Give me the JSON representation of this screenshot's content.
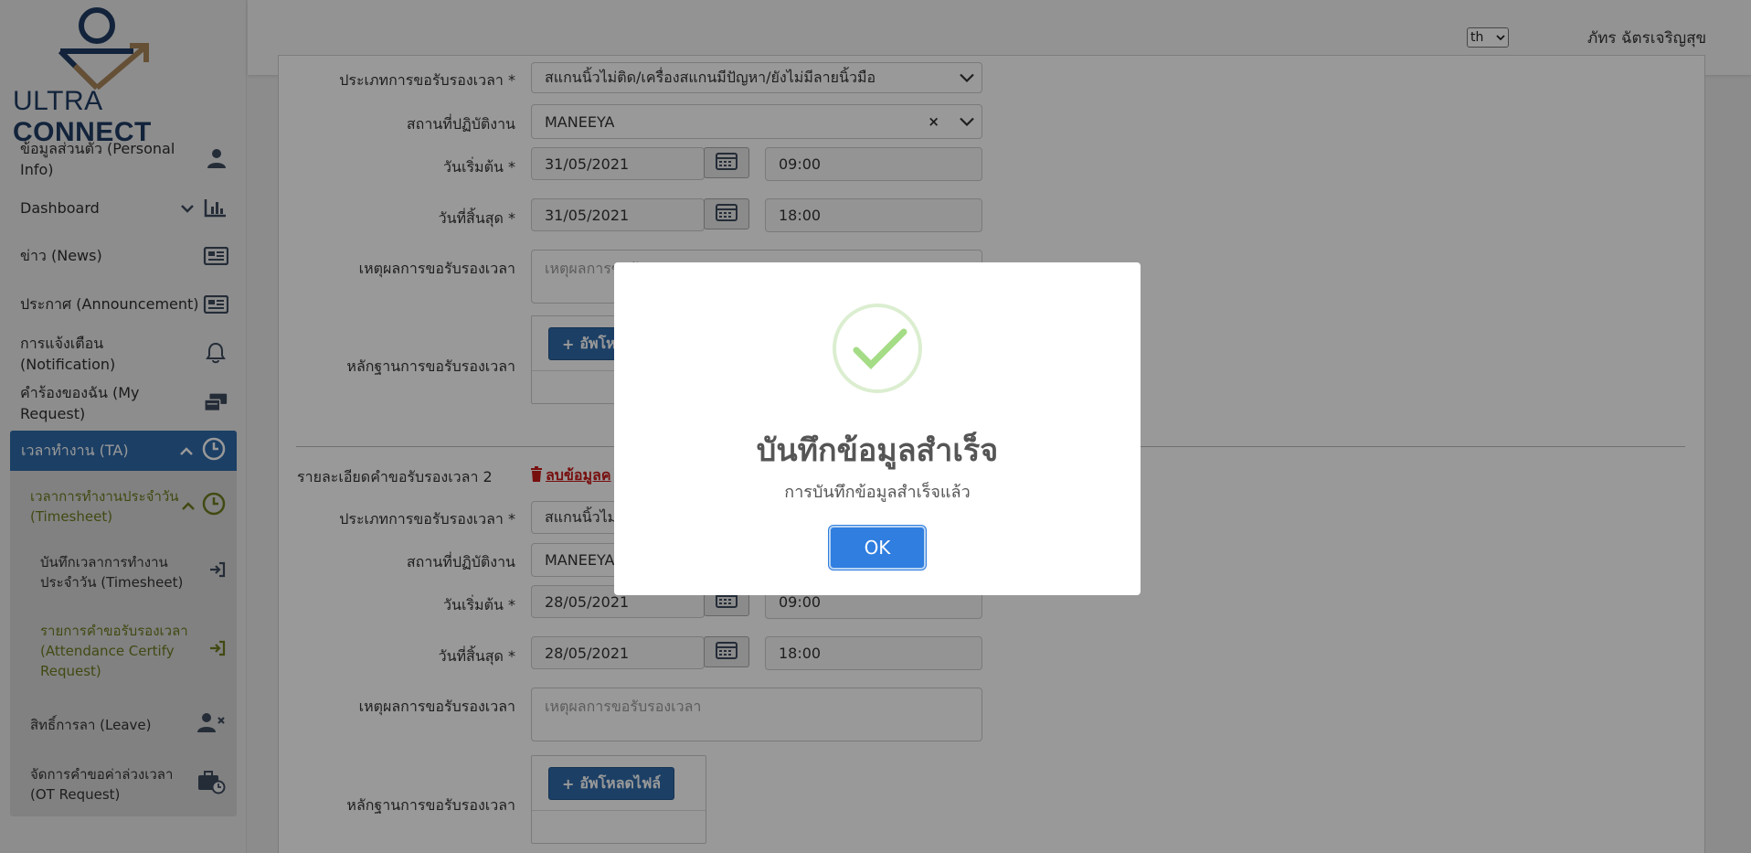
{
  "brand": {
    "logo_left": "ULTRA",
    "logo_right": "CONNECT"
  },
  "sidebar": {
    "items": [
      {
        "label": "ข้อมูลส่วนตัว (Personal Info)",
        "icon": "user-icon"
      },
      {
        "label": "Dashboard",
        "icon": "bar-chart-icon"
      },
      {
        "label": "ข่าว (News)",
        "icon": "newspaper-icon"
      },
      {
        "label": "ประกาศ (Announcement)",
        "icon": "newspaper-icon"
      },
      {
        "label": "การแจ้งเตือน (Notification)",
        "icon": "bell-icon"
      },
      {
        "label": "คำร้องของฉัน (My Request)",
        "icon": "inbox-icon"
      }
    ],
    "ta": {
      "label": "เวลาทำงาน (TA)",
      "timesheet_group": "เวลาการทำงานประจำวัน (Timesheet)",
      "timesheet_group_l1": "เวลาการทำงานประจำวัน",
      "timesheet_group_l2": "(Timesheet)",
      "record_l1": "บันทึกเวลาการทำงาน",
      "record_l2": "ประจำวัน (Timesheet)",
      "cert_l1": "รายการคำขอรับรองเวลา",
      "cert_l2": "(Attendance Certify",
      "cert_l3": "Request)",
      "leave": "สิทธิ์การลา (Leave)",
      "ot_l1": "จัดการคำขอค่าล่วงเวลา",
      "ot_l2": "(OT Request)"
    }
  },
  "topbar": {
    "lang": "th",
    "user": "ภัทร ฉัตรเจริญสุข"
  },
  "form": {
    "type_label": "ประเภทการขอรับรองเวลา *",
    "type_value_1": "สแกนนิ้วไม่ติด/เครื่องสแกนมีปัญหา/ยังไม่มีลายนิ้วมือ",
    "place_label": "สถานที่ปฏิบัติงาน",
    "place_value": "MANEEYA",
    "start_label": "วันเริ่มต้น *",
    "end_label": "วันที่สิ้นสุด *",
    "reason_label": "เหตุผลการขอรับรองเวลา",
    "reason_placeholder": "เหตุผลการขอรับรองเวลา",
    "reason_placeholder_short": "เหตุผลการขอรั",
    "evidence_label": "หลักฐานการขอรับรองเวลา",
    "upload_label": "อัพโหลดไฟล์",
    "upload_label_short": "อัพโห",
    "entry1": {
      "start_date": "31/05/2021",
      "start_time": "09:00",
      "end_date": "31/05/2021",
      "end_time": "18:00"
    },
    "section2_title": "รายละเอียดคำขอรับรองเวลา 2",
    "delete_label": "ลบข้อมูลค",
    "entry2": {
      "type_value": "สแกนนิ้วไม่",
      "place_value": "MANEEYA",
      "start_date": "28/05/2021",
      "start_time": "09:00",
      "end_date": "28/05/2021",
      "end_time": "18:00"
    }
  },
  "modal": {
    "title": "บันทึกข้อมูลสำเร็จ",
    "text": "การบันทึกข้อมูลสำเร็จแล้ว",
    "ok": "OK",
    "icon": "check-icon",
    "success_color": "#a5dc86"
  }
}
